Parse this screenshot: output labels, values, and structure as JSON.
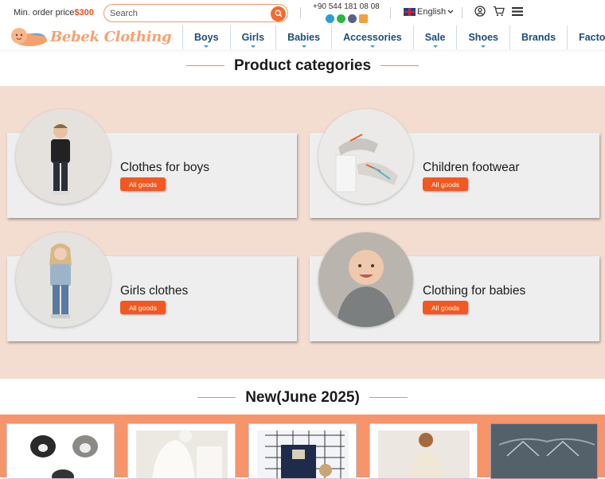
{
  "header": {
    "min_order_label": "Min. order price",
    "min_order_value": "$300",
    "search_placeholder": "Search",
    "phone": "+90 544 181 08 08",
    "language": "English",
    "social_icons": [
      "telegram-icon",
      "whatsapp-icon",
      "viber-icon",
      "email-icon"
    ]
  },
  "logo": {
    "text": "Bebek Clothing"
  },
  "nav": {
    "items": [
      {
        "label": "Boys"
      },
      {
        "label": "Girls"
      },
      {
        "label": "Babies"
      },
      {
        "label": "Accessories"
      },
      {
        "label": "Sale"
      },
      {
        "label": "Shoes"
      },
      {
        "label": "Brands"
      },
      {
        "label": "Factories"
      }
    ]
  },
  "categories": {
    "title": "Product categories",
    "items": [
      {
        "name": "Clothes for boys",
        "button": "All goods"
      },
      {
        "name": "Children footwear",
        "button": "All goods"
      },
      {
        "name": "Girls clothes",
        "button": "All goods"
      },
      {
        "name": "Clothing for babies",
        "button": "All goods"
      }
    ]
  },
  "new_products": {
    "title": "New(June 2025)"
  },
  "colors": {
    "accent": "#f2581f",
    "nav_text": "#1c4e7a",
    "category_bg": "#f3ddd0",
    "new_bg": "#f7946a"
  }
}
